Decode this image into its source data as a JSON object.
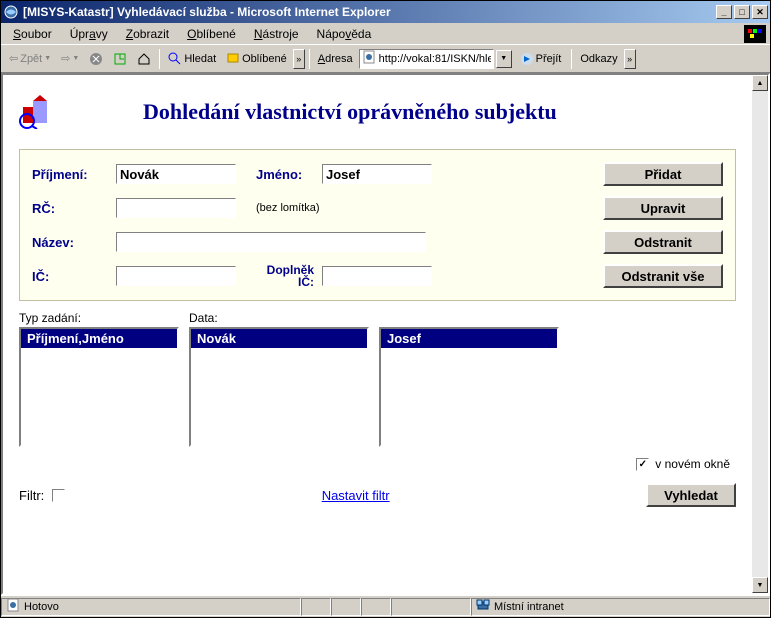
{
  "window": {
    "title": "[MISYS-Katastr] Vyhledávací služba - Microsoft Internet Explorer"
  },
  "menus": {
    "soubor": "Soubor",
    "upravy": "Úpravy",
    "zobrazit": "Zobrazit",
    "oblibene": "Oblíbené",
    "nastroje": "Nástroje",
    "napoveda": "Nápověda"
  },
  "toolbar": {
    "zpet": "Zpět",
    "hledat": "Hledat",
    "oblibene": "Oblíbené",
    "adresa_label": "Adresa",
    "adresa_value": "http://vokal:81/ISKN/hle",
    "prejit": "Přejít",
    "odkazy": "Odkazy"
  },
  "page": {
    "title": "Dohledání vlastnictví oprávněného subjektu"
  },
  "form": {
    "prijmeni_label": "Příjmení:",
    "prijmeni_value": "Novák",
    "jmeno_label": "Jméno:",
    "jmeno_value": "Josef",
    "rc_label": "RČ:",
    "rc_value": "",
    "rc_hint": "(bez lomítka)",
    "nazev_label": "Název:",
    "nazev_value": "",
    "ic_label": "IČ:",
    "ic_value": "",
    "doplnek_label_1": "Doplněk",
    "doplnek_label_2": "IČ:",
    "doplnek_value": ""
  },
  "buttons": {
    "pridat": "Přidat",
    "upravit": "Upravit",
    "odstranit": "Odstranit",
    "odstranit_vse": "Odstranit vše",
    "vyhledat": "Vyhledat"
  },
  "lists": {
    "typ_label": "Typ zadání:",
    "data_label": "Data:",
    "typ_item": "Příjmení,Jméno",
    "data1_item": "Novák",
    "data2_item": "Josef"
  },
  "bottom": {
    "filtr_label": "Filtr:",
    "nastavit_filtr": "Nastavit filtr",
    "nove_okno": "v novém okně"
  },
  "status": {
    "hotovo": "Hotovo",
    "zone": "Místní intranet"
  }
}
